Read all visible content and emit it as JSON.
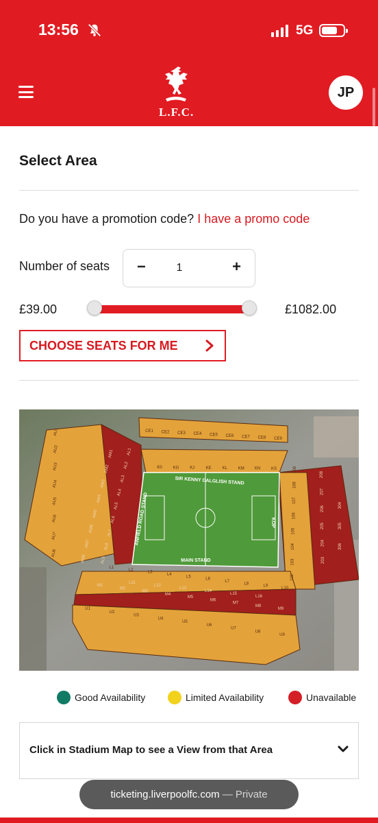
{
  "status": {
    "time": "13:56",
    "network": "5G"
  },
  "header": {
    "logo_text": "L.F.C.",
    "avatar_initials": "JP",
    "icons": {
      "menu": "hamburger-menu-icon",
      "mute": "bell-slash-icon",
      "logo": "liverbird-icon"
    }
  },
  "page": {
    "title": "Select Area",
    "promo_question": "Do you have a promotion code?",
    "promo_link": "I have a promo code",
    "seats_label": "Number of seats",
    "seats_value": "1",
    "minus_label": "−",
    "plus_label": "+",
    "price_min": "£39.00",
    "price_max": "£1082.00",
    "price_range_fraction": [
      0.0,
      1.0
    ],
    "choose_button": "CHOOSE SEATS FOR ME"
  },
  "stadium_map": {
    "stands": {
      "north": "SIR KENNY DALGLISH STAND",
      "west": "ANFIELD ROAD STAND",
      "east": "KOP",
      "south": "MAIN STAND"
    },
    "blocks": {
      "upper_north": [
        "CE1",
        "CE2",
        "CE3",
        "CE4",
        "CE5",
        "CE6",
        "CE7",
        "CE8",
        "CE9"
      ],
      "lower_north": [
        "K0",
        "KG",
        "KJ",
        "KE",
        "KL",
        "KM",
        "KN",
        "KS"
      ],
      "upper_west": [
        "AU1",
        "AU2",
        "AU3",
        "AU4",
        "AU5",
        "AU6",
        "AU7",
        "AU8"
      ],
      "mid_west": [
        "AM1",
        "AM2",
        "AM3",
        "AM4",
        "AM5",
        "AM6",
        "AM7",
        "AM8"
      ],
      "lower_west": [
        "AL1",
        "AL2",
        "AL3",
        "AL4",
        "AL5",
        "AL6",
        "AL7",
        "AL8",
        "AL9"
      ],
      "kop_upper": [
        "208",
        "207",
        "206",
        "205",
        "204",
        "203"
      ],
      "kop_lower": [
        "109",
        "108",
        "107",
        "106",
        "105",
        "104",
        "103",
        "102"
      ],
      "kop_far": [
        "304",
        "305",
        "306"
      ],
      "main_lower": [
        "L1",
        "L2",
        "L3",
        "L4",
        "L5",
        "L6",
        "L7",
        "L8",
        "L9",
        "L10"
      ],
      "main_mid_a": [
        "L11",
        "L12",
        "L13",
        "L14",
        "L15",
        "L16"
      ],
      "main_mid_b": [
        "M1",
        "M2",
        "M3",
        "M4",
        "M5",
        "M6",
        "M7",
        "M8",
        "M9"
      ],
      "main_upper": [
        "U1",
        "U2",
        "U3",
        "U4",
        "U5",
        "U6",
        "U7",
        "U8",
        "U9"
      ]
    },
    "colors": {
      "available": "#e3a33a",
      "unavailable": "#a11f1c",
      "pitch": "#4f9a3a"
    }
  },
  "legend": [
    {
      "label": "Good Availability",
      "color": "#117a65"
    },
    {
      "label": "Limited Availability",
      "color": "#f2d21b"
    },
    {
      "label": "Unavailable",
      "color": "#d51f26"
    }
  ],
  "accordion": {
    "text": "Click in Stadium Map to see a View from that Area",
    "icon": "chevron-down-icon"
  },
  "browser": {
    "url": "ticketing.liverpoolfc.com",
    "private_label": "— Private"
  }
}
